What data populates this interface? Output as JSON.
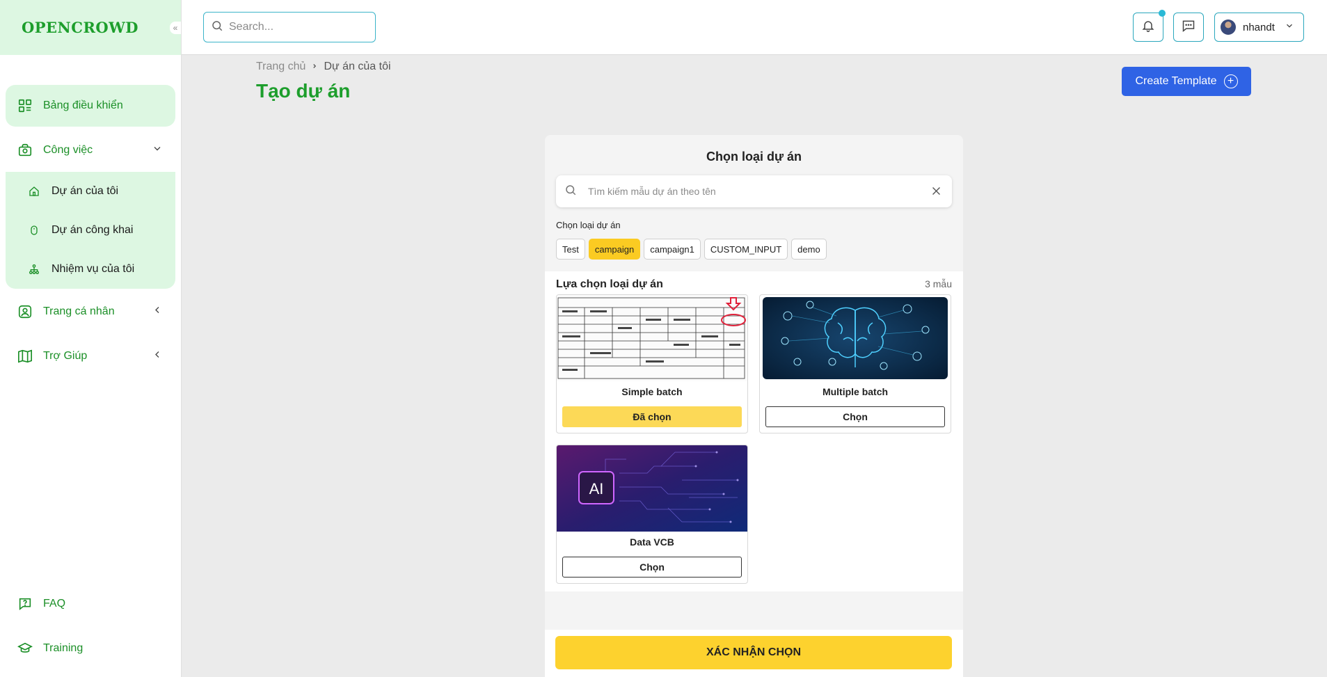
{
  "app": {
    "logo": "OPENCROWD"
  },
  "sidebar": {
    "collapse_icon": "«",
    "items": [
      {
        "label": "Bảng điều khiển",
        "icon": "dashboard-icon"
      },
      {
        "label": "Công việc",
        "icon": "work-icon"
      },
      {
        "label": "Trang cá nhân",
        "icon": "profile-icon"
      },
      {
        "label": "Trợ Giúp",
        "icon": "book-icon"
      }
    ],
    "submenu": [
      {
        "label": "Dự án của tôi",
        "icon": "home-icon"
      },
      {
        "label": "Dự án công khai",
        "icon": "mouse-icon"
      },
      {
        "label": "Nhiệm vụ của tôi",
        "icon": "sitemap-icon"
      }
    ],
    "bottom": [
      {
        "label": "FAQ",
        "icon": "help-icon"
      },
      {
        "label": "Training",
        "icon": "graduation-icon"
      }
    ]
  },
  "topbar": {
    "search_placeholder": "Search...",
    "user_name": "nhandt"
  },
  "page": {
    "breadcrumb": [
      "Trang chủ",
      "Dự án của tôi"
    ],
    "title": "Tạo dự án",
    "create_button": "Create Template"
  },
  "panel": {
    "title": "Chọn loại dự án",
    "search_placeholder": "Tìm kiếm mẫu dự án theo tên",
    "filter_label": "Chọn loại dự án",
    "chips": [
      "Test",
      "campaign",
      "campaign1",
      "CUSTOM_INPUT",
      "demo"
    ],
    "active_chip": "campaign",
    "list_title": "Lựa chọn loại dự án",
    "count": "3 mẫu",
    "cards": [
      {
        "name": "Simple batch",
        "button": "Đã chọn",
        "selected": true
      },
      {
        "name": "Multiple batch",
        "button": "Chọn",
        "selected": false
      },
      {
        "name": "Data VCB",
        "button": "Chọn",
        "selected": false
      }
    ],
    "confirm": "XÁC NHẬN CHỌN"
  },
  "colors": {
    "brand_green": "#1d9e2c",
    "accent_yellow": "#fdd22e",
    "primary_blue": "#2f63e5",
    "teal": "#2aa7bd"
  }
}
